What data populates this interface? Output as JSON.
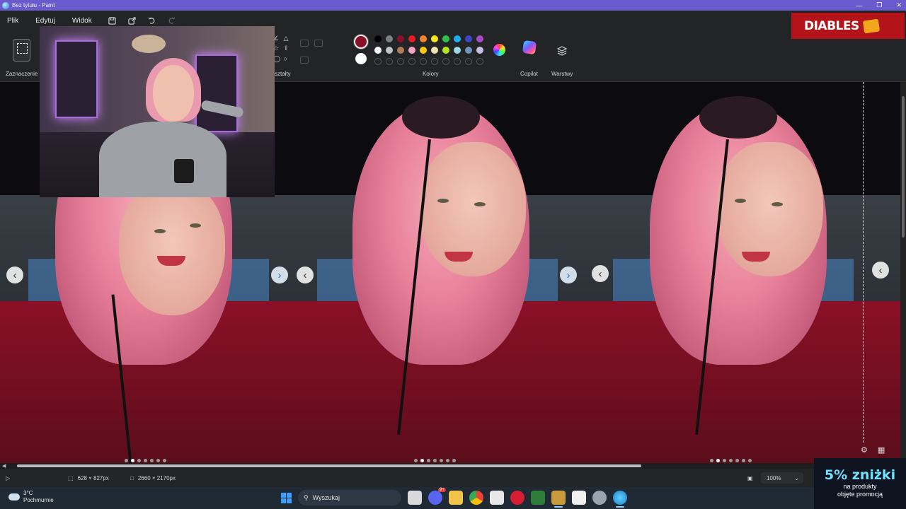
{
  "window": {
    "title": "Bez tytułu - Paint"
  },
  "menu": {
    "items": [
      "Plik",
      "Edytuj",
      "Widok"
    ]
  },
  "ribbon": {
    "selection_label": "Zaznaczenie",
    "shapes_label_partial": "ształty",
    "colors_label": "Kolory",
    "copilot_label": "Copilot",
    "layers_label": "Warstwy",
    "primary_color": "#8a1028",
    "secondary_color": "#ffffff",
    "palette_row1": [
      "#000000",
      "#7f7f7f",
      "#8a1028",
      "#e81b23",
      "#f7832a",
      "#ffe31c",
      "#2fc04b",
      "#18aef0",
      "#3c48cc",
      "#a64ac9"
    ],
    "palette_row2": [
      "#ffffff",
      "#c3c3c3",
      "#b07d5a",
      "#f6a5c6",
      "#ffc90e",
      "#efe4b0",
      "#b5e61d",
      "#99d9ea",
      "#7092be",
      "#c8bfe7"
    ]
  },
  "brand": {
    "name": "DIABLES"
  },
  "canvas": {
    "photo_count": 3,
    "nav_prev": "‹",
    "nav_next": "›",
    "carousel_dots": 7,
    "active_dot_index": 1
  },
  "status": {
    "selection_size": "628 × 827px",
    "canvas_size": "2660 × 2170px",
    "zoom": "100%"
  },
  "taskbar": {
    "temperature": "3°C",
    "weather": "Pochmurnie",
    "search_placeholder": "Wyszukaj",
    "notification_badge": "9+",
    "apps": [
      "file-explorer-icon",
      "discord-icon",
      "folder-icon",
      "chrome-icon",
      "app-icon",
      "app-red-icon",
      "app-green-icon",
      "lol-icon",
      "app-doc-icon",
      "app-shield-icon",
      "paint-icon"
    ]
  },
  "promo": {
    "headline": "5% zniżki",
    "line1": "na produkty",
    "line2": "objęte promocją"
  }
}
